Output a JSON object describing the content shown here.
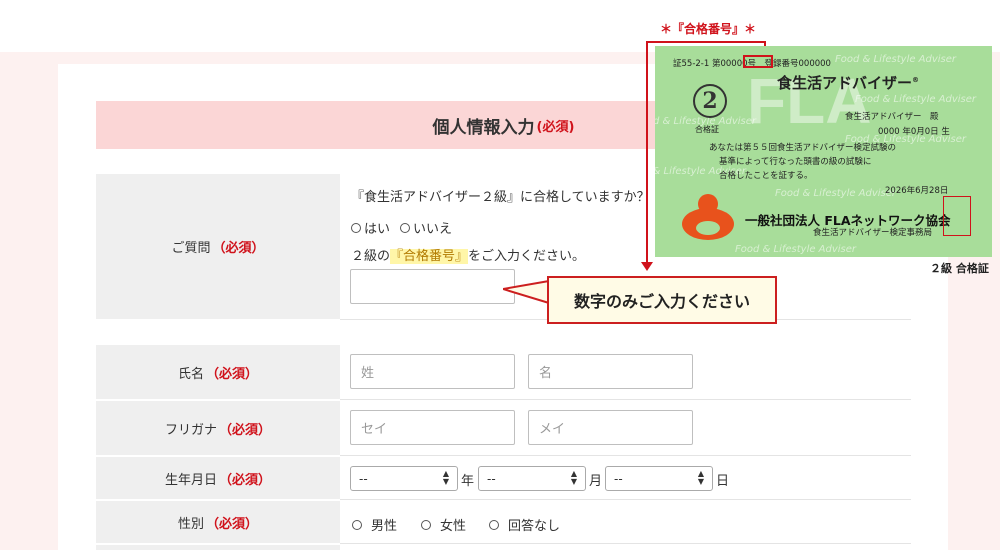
{
  "section": {
    "title": "個人情報入力",
    "required": "(必須)"
  },
  "question": {
    "label": "ご質問",
    "required": "（必須）",
    "prompt": "『食生活アドバイザー２級』に合格していますか？",
    "options": [
      "はい",
      "いいえ"
    ],
    "instruction_before": "２級の",
    "instruction_highlight": "『合格番号』",
    "instruction_after": "をご入力ください。",
    "input_value": ""
  },
  "callout": {
    "text": "数字のみご入力ください"
  },
  "name": {
    "label": "氏名",
    "required": "（必須）",
    "last_placeholder": "姓",
    "first_placeholder": "名"
  },
  "furigana": {
    "label": "フリガナ",
    "required": "（必須）",
    "last_placeholder": "セイ",
    "first_placeholder": "メイ"
  },
  "birthdate": {
    "label": "生年月日",
    "required": "（必須）",
    "year": "--",
    "month": "--",
    "day": "--",
    "year_unit": "年",
    "month_unit": "月",
    "day_unit": "日"
  },
  "gender": {
    "label": "性別",
    "required": "（必須）",
    "options": [
      "男性",
      "女性",
      "回答なし"
    ]
  },
  "certificate": {
    "annotation": "＊『合格番号』＊",
    "line1": "証55-2-1 第00000号　登録番号000000",
    "title": "食生活アドバイザー",
    "registered_mark": "®",
    "grade": "2",
    "grade_label": "合格証",
    "recipient": "食生活アドバイザー　殿",
    "birth": "0000 年0月0日 生",
    "body1": "あなたは第５５回食生活アドバイザー検定試験の",
    "body2": "基準によって行なった頭書の級の試験に",
    "body3": "合格したことを証する。",
    "date": "2026年6月28日",
    "org": "一般社団法人 FLAネットワーク協会",
    "org_sub": "食生活アドバイザー検定事務局",
    "watermark_text": "Food & Lifestyle Adviser",
    "watermark_logo": "FLA",
    "caption": "２級 合格証"
  },
  "colors": {
    "accent_red": "#d0121b",
    "header_pink": "#fbd6d6",
    "page_bg": "#fdf1f0",
    "certificate_green": "#a8dd9a"
  }
}
